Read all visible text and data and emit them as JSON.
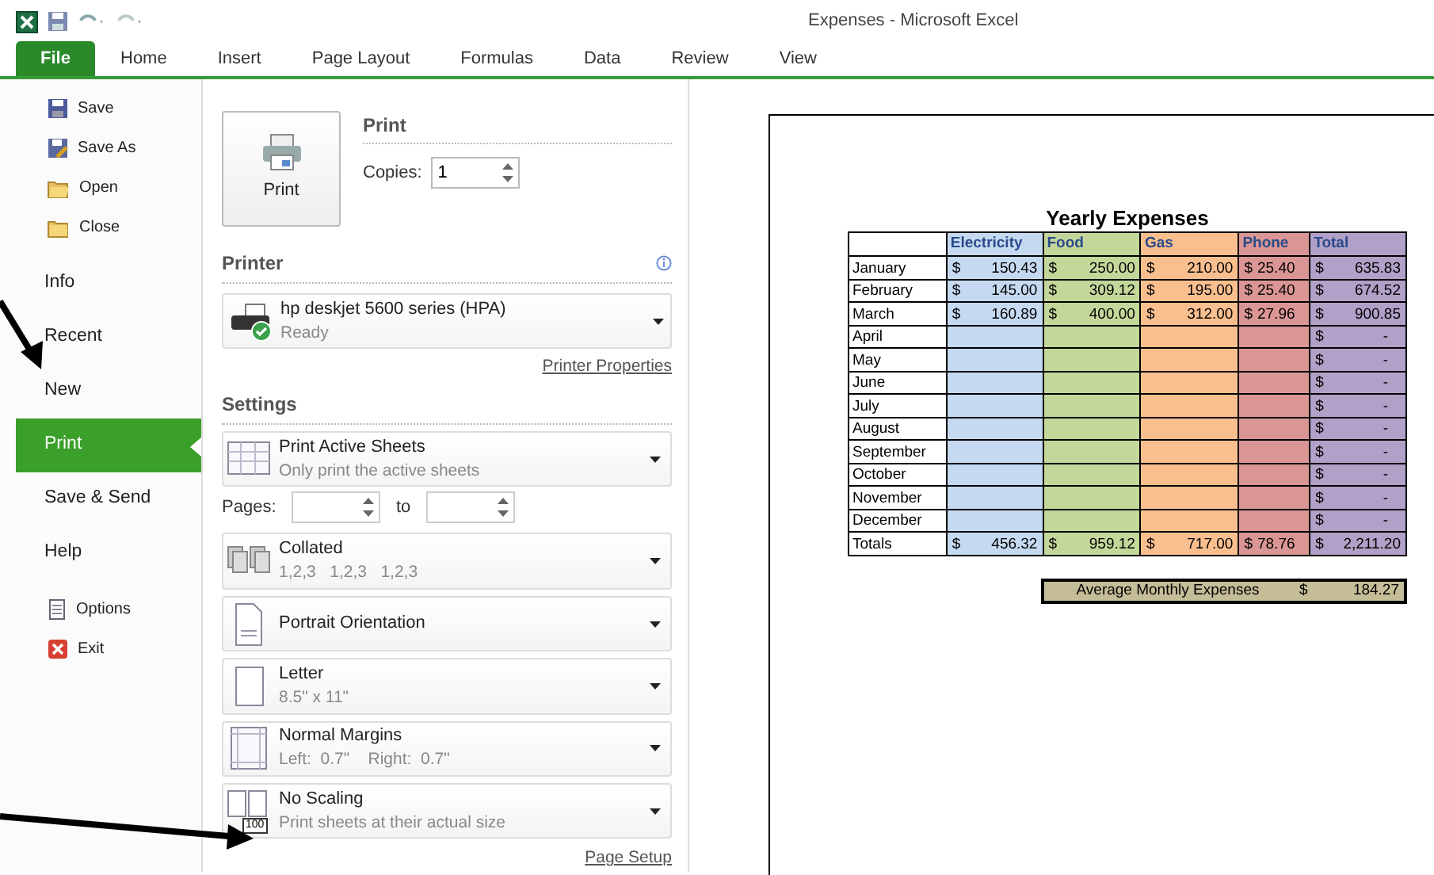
{
  "window": {
    "title": "Expenses - Microsoft Excel"
  },
  "ribbon_tabs": [
    {
      "label": "File",
      "selected": true
    },
    {
      "label": "Home",
      "selected": false
    },
    {
      "label": "Insert",
      "selected": false
    },
    {
      "label": "Page Layout",
      "selected": false
    },
    {
      "label": "Formulas",
      "selected": false
    },
    {
      "label": "Data",
      "selected": false
    },
    {
      "label": "Review",
      "selected": false
    },
    {
      "label": "View",
      "selected": false
    }
  ],
  "backstage_menu": [
    {
      "label": "Save",
      "kind": "command",
      "selected": false
    },
    {
      "label": "Save As",
      "kind": "command",
      "selected": false
    },
    {
      "label": "Open",
      "kind": "command",
      "selected": false
    },
    {
      "label": "Close",
      "kind": "command",
      "selected": false
    },
    {
      "label": "Info",
      "kind": "section",
      "selected": false
    },
    {
      "label": "Recent",
      "kind": "section",
      "selected": false
    },
    {
      "label": "New",
      "kind": "section",
      "selected": false
    },
    {
      "label": "Print",
      "kind": "section",
      "selected": true
    },
    {
      "label": "Save & Send",
      "kind": "section",
      "selected": false
    },
    {
      "label": "Help",
      "kind": "section",
      "selected": false
    },
    {
      "label": "Options",
      "kind": "command",
      "selected": false
    },
    {
      "label": "Exit",
      "kind": "command",
      "selected": false
    }
  ],
  "print": {
    "button": "Print",
    "heading": "Print",
    "copies_label": "Copies:",
    "copies": "1"
  },
  "printer": {
    "heading": "Printer",
    "name": "hp deskjet 5600 series (HPA)",
    "status": "Ready",
    "link": "Printer Properties"
  },
  "settings": {
    "heading": "Settings",
    "pages_label": "Pages:",
    "to_label": "to",
    "link": "Page Setup",
    "options": [
      {
        "title": "Print Active Sheets",
        "subtitle": "Only print the active sheets"
      },
      {
        "title": "Collated",
        "subtitle": "1,2,3   1,2,3   1,2,3"
      },
      {
        "title": "Portrait Orientation"
      },
      {
        "title": "Letter",
        "subtitle": "8.5\" x 11\""
      },
      {
        "title": "Normal Margins",
        "subtitle": "Left:  0.7\"    Right:  0.7\""
      },
      {
        "title": "No Scaling",
        "subtitle": "Print sheets at their actual size",
        "badge": "100"
      }
    ]
  },
  "preview": {
    "title": "Yearly Expenses",
    "columns": [
      {
        "label": "Electricity",
        "color": "#c5d9f1"
      },
      {
        "label": "Food",
        "color": "#c4d79b"
      },
      {
        "label": "Gas",
        "color": "#fabf8f"
      },
      {
        "label": "Phone",
        "color": "#da9694"
      },
      {
        "label": "Total",
        "color": "#b1a0c7"
      }
    ],
    "rows": [
      {
        "label": "January",
        "cells": [
          [
            "$",
            "150.43"
          ],
          [
            "$",
            "250.00"
          ],
          [
            "$",
            "210.00"
          ],
          [
            "$",
            "25.40"
          ],
          [
            "$",
            "635.83"
          ]
        ]
      },
      {
        "label": "February",
        "cells": [
          [
            "$",
            "145.00"
          ],
          [
            "$",
            "309.12"
          ],
          [
            "$",
            "195.00"
          ],
          [
            "$",
            "25.40"
          ],
          [
            "$",
            "674.52"
          ]
        ]
      },
      {
        "label": "March",
        "cells": [
          [
            "$",
            "160.89"
          ],
          [
            "$",
            "400.00"
          ],
          [
            "$",
            "312.00"
          ],
          [
            "$",
            "27.96"
          ],
          [
            "$",
            "900.85"
          ]
        ]
      },
      {
        "label": "April",
        "cells": [
          [],
          [],
          [],
          [],
          [
            "$",
            "-"
          ]
        ]
      },
      {
        "label": "May",
        "cells": [
          [],
          [],
          [],
          [],
          [
            "$",
            "-"
          ]
        ]
      },
      {
        "label": "June",
        "cells": [
          [],
          [],
          [],
          [],
          [
            "$",
            "-"
          ]
        ]
      },
      {
        "label": "July",
        "cells": [
          [],
          [],
          [],
          [],
          [
            "$",
            "-"
          ]
        ]
      },
      {
        "label": "August",
        "cells": [
          [],
          [],
          [],
          [],
          [
            "$",
            "-"
          ]
        ]
      },
      {
        "label": "September",
        "cells": [
          [],
          [],
          [],
          [],
          [
            "$",
            "-"
          ]
        ]
      },
      {
        "label": "October",
        "cells": [
          [],
          [],
          [],
          [],
          [
            "$",
            "-"
          ]
        ]
      },
      {
        "label": "November",
        "cells": [
          [],
          [],
          [],
          [],
          [
            "$",
            "-"
          ]
        ]
      },
      {
        "label": "December",
        "cells": [
          [],
          [],
          [],
          [],
          [
            "$",
            "-"
          ]
        ]
      },
      {
        "label": "Totals",
        "cells": [
          [
            "$",
            "456.32"
          ],
          [
            "$",
            "959.12"
          ],
          [
            "$",
            "717.00"
          ],
          [
            "$",
            "78.76"
          ],
          [
            "$",
            "2,211.20"
          ]
        ]
      }
    ],
    "average": {
      "label": "Average Monthly Expenses",
      "currency": "$",
      "value": "184.27"
    }
  }
}
